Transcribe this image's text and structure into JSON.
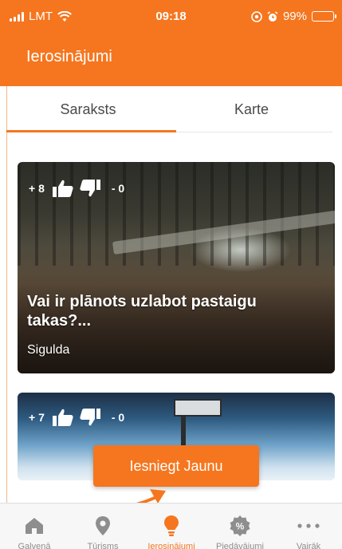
{
  "status_bar": {
    "carrier": "LMT",
    "time": "09:18",
    "battery": "99%"
  },
  "header": {
    "title": "Ierosinājumi"
  },
  "tabs": [
    {
      "label": "Saraksts",
      "active": true
    },
    {
      "label": "Karte",
      "active": false
    }
  ],
  "cards": [
    {
      "upvotes": "+ 8",
      "downvotes": "- 0",
      "title": "Vai ir plānots uzlabot pastaigu takas?...",
      "location": "Sigulda"
    },
    {
      "upvotes": "+ 7",
      "downvotes": "- 0"
    }
  ],
  "submit_button": {
    "label": "Iesniegt Jaunu"
  },
  "bottom_nav": [
    {
      "label": "Galvenā",
      "icon": "home-icon",
      "active": false
    },
    {
      "label": "Tūrisms",
      "icon": "map-pin-icon",
      "active": false
    },
    {
      "label": "Ierosinājumi",
      "icon": "lightbulb-icon",
      "active": true
    },
    {
      "label": "Piedāvājumi",
      "icon": "percent-badge-icon",
      "active": false
    },
    {
      "label": "Vairāk",
      "icon": "more-icon",
      "active": false
    }
  ],
  "colors": {
    "accent": "#f5761f",
    "inactive": "#8e8e8e"
  }
}
